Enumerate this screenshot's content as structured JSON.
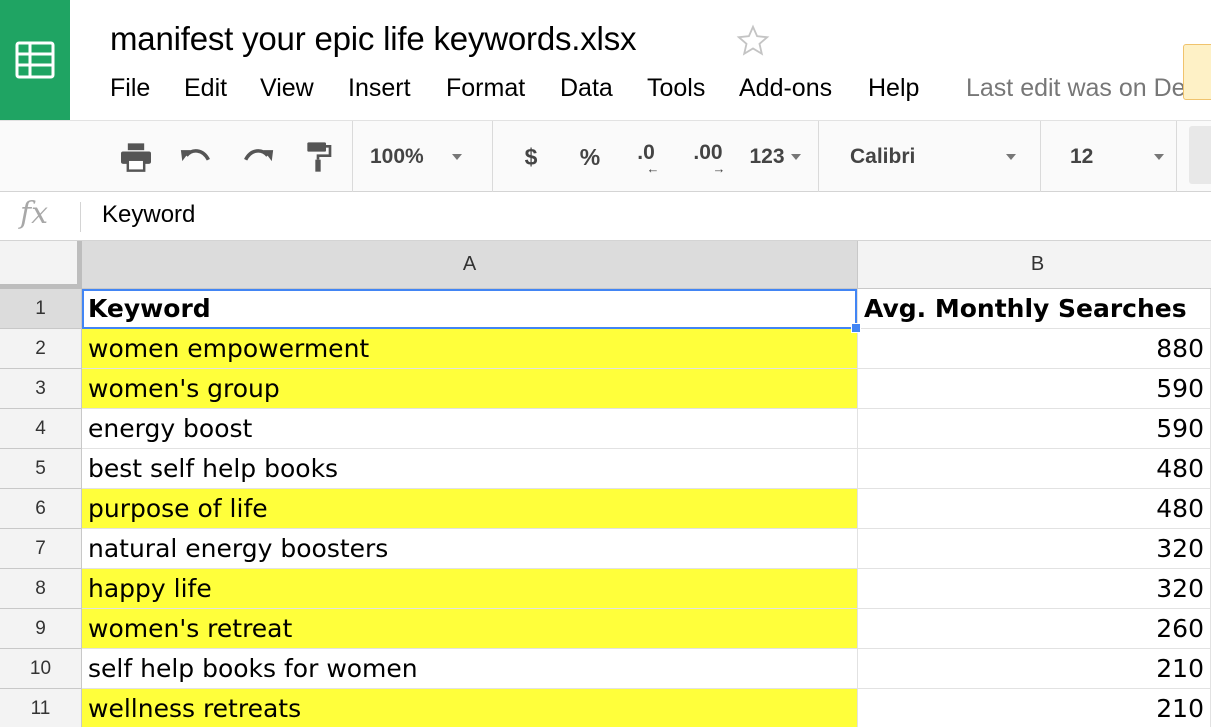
{
  "app": {
    "doc_title": "manifest your epic life keywords.xlsx",
    "last_edit": "Last edit was on De",
    "brand_color": "#1fa463",
    "logo_icon": "sheets-logo-icon",
    "star_icon": "star-outline-icon"
  },
  "menu": [
    "File",
    "Edit",
    "View",
    "Insert",
    "Format",
    "Data",
    "Tools",
    "Add-ons",
    "Help"
  ],
  "toolbar": {
    "zoom": "100%",
    "currency": "$",
    "percent": "%",
    "decrease_decimal": ".0",
    "increase_decimal": ".00",
    "more_formats": "123",
    "font": "Calibri",
    "font_size": "12",
    "icons": [
      "print-icon",
      "undo-icon",
      "redo-icon",
      "paint-format-icon"
    ]
  },
  "formula_bar": {
    "fx_label": "fx",
    "value": "Keyword"
  },
  "grid": {
    "columns": [
      "A",
      "B"
    ],
    "highlight_color": "#ffff3b",
    "selected_cell": "A1",
    "rows": [
      {
        "num": "1",
        "a": "Keyword",
        "b": "Avg. Monthly Searches",
        "header": true,
        "hl": false
      },
      {
        "num": "2",
        "a": "women empowerment",
        "b": "880",
        "hl": true
      },
      {
        "num": "3",
        "a": "women's group",
        "b": "590",
        "hl": true
      },
      {
        "num": "4",
        "a": "energy boost",
        "b": "590",
        "hl": false
      },
      {
        "num": "5",
        "a": "best self help books",
        "b": "480",
        "hl": false
      },
      {
        "num": "6",
        "a": "purpose of life",
        "b": "480",
        "hl": true
      },
      {
        "num": "7",
        "a": "natural energy boosters",
        "b": "320",
        "hl": false
      },
      {
        "num": "8",
        "a": "happy life",
        "b": "320",
        "hl": true
      },
      {
        "num": "9",
        "a": "women's retreat",
        "b": "260",
        "hl": true
      },
      {
        "num": "10",
        "a": "self help books for women",
        "b": "210",
        "hl": false
      },
      {
        "num": "11",
        "a": "wellness retreats",
        "b": "210",
        "hl": true
      }
    ]
  }
}
